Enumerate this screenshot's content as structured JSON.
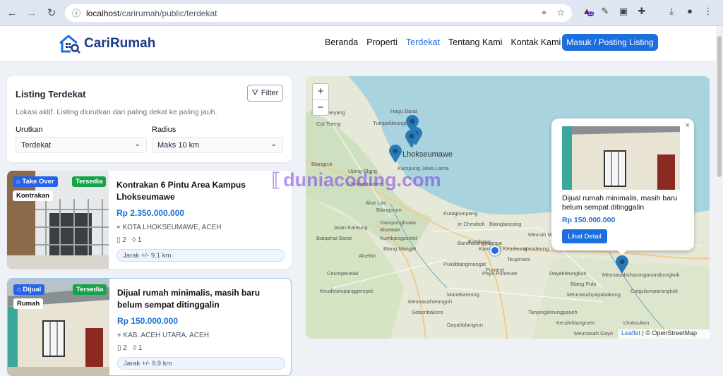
{
  "browser": {
    "url_host": "localhost",
    "url_path": "/carirumah/public/terdekat",
    "ext_badge": "11"
  },
  "nav": {
    "brand": "CariRumah",
    "links": [
      "Beranda",
      "Properti",
      "Terdekat",
      "Tentang Kami",
      "Kontak Kami"
    ],
    "active": "Terdekat",
    "cta": "Masuk / Posting Listing"
  },
  "panel": {
    "title": "Listing Terdekat",
    "filter_label": "Filter",
    "description": "Lokasi aktif. Listing diurutkan dari paling dekat ke paling jauh.",
    "sort_label": "Urutkan",
    "sort_value": "Terdekat",
    "radius_label": "Radius",
    "radius_value": "Maks 10 km"
  },
  "listings": [
    {
      "type_badge": "Take Over",
      "category": "Kontrakan",
      "status": "Tersedia",
      "title": "Kontrakan 6 Pintu Area Kampus Lhokseumawe",
      "price": "Rp 2.350.000.000",
      "location": "KOTA LHOKSEUMAWE, ACEH",
      "rooms": "2",
      "baths": "1",
      "distance": "Jarak +/- 9.1 km"
    },
    {
      "type_badge": "Dijual",
      "category": "Rumah",
      "status": "Tersedia",
      "title": "Dijual rumah minimalis, masih baru belum sempat ditinggalin",
      "price": "Rp 150.000.000",
      "location": "KAB. ACEH UTARA, ACEH",
      "rooms": "2",
      "baths": "1",
      "distance": "Jarak +/- 9.9 km"
    }
  ],
  "map": {
    "zoom_in": "+",
    "zoom_out": "−",
    "place_labels": [
      "Blangpanyang",
      "Hagu Barat",
      "Cot Trieng",
      "Tumpokteungoh",
      "Lhokseumawe",
      "Kampung Jawa Lama",
      "Blangcut",
      "Ujong Blang",
      "Lhokseumawe",
      "Blangcrum",
      "Gampongkuala",
      "Alue Lim",
      "Alueawe",
      "Blang Mangat",
      "Kumbangpuntet",
      "Batuphat Barat",
      "Asan Kareung",
      "Kutaglumpang",
      "Ie Cheuboh",
      "Blanglancang",
      "Kumbang",
      "Kampung Keudeung",
      "Teupinara",
      "Keudeung",
      "Aluelim",
      "Barohblangjeumpa",
      "Meurah Mulia",
      "Pulolblangmangat",
      "Punteut",
      "Dayahteungkuh",
      "Meunasahsharonganarabungkok",
      "Blang Pulo",
      "Ceumpeudak",
      "Manekareung",
      "Paya Punteuet",
      "Keudesimpanggempet",
      "Meunasahteungoh",
      "Meunasahpayabakong",
      "Cotgulumparangkok",
      "Lhoksukon",
      "Sebonbakoro",
      "Tanjongkreungpaseh",
      "Dayahblangrun",
      "Keudeblangruen",
      "Meunasah Gayo"
    ],
    "popup": {
      "close": "×",
      "title": "Dijual rumah minimalis, masih baru belum sempat ditinggalin",
      "price": "Rp 150.000.000",
      "button": "Lihat Detail"
    },
    "attribution_leaflet": "Leaflet",
    "attribution_sep": " | © OpenStreetMap"
  },
  "watermark": "duniacoding.com",
  "colors": {
    "primary": "#1d6fe0",
    "brand": "#1e3a8a",
    "badge_blue": "#2563eb",
    "badge_green": "#16a34a"
  }
}
